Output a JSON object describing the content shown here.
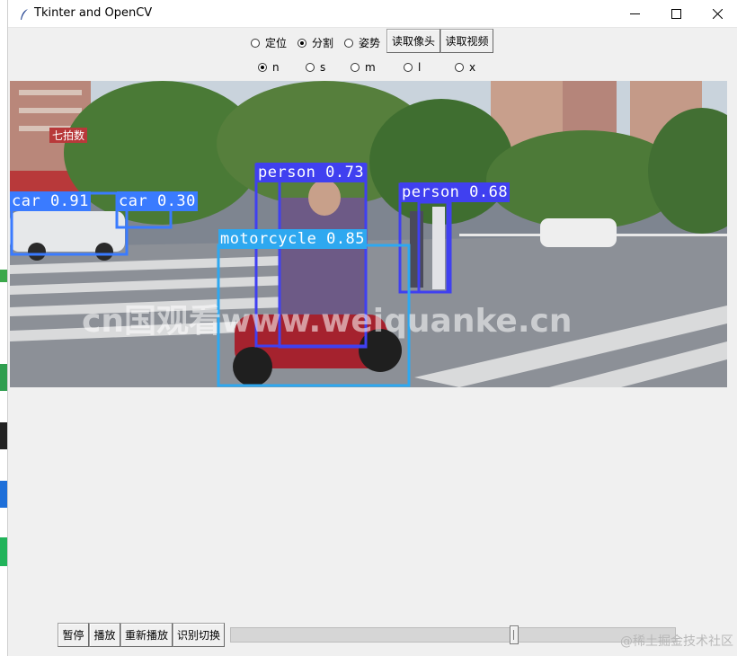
{
  "window": {
    "title": "Tkinter and OpenCV"
  },
  "toolbar": {
    "modes": [
      {
        "label": "定位",
        "selected": false
      },
      {
        "label": "分割",
        "selected": true
      },
      {
        "label": "姿势",
        "selected": false
      }
    ],
    "buttons": {
      "read_camera": "读取像头",
      "read_video": "读取视频"
    },
    "model_sizes": [
      {
        "label": "n",
        "selected": true
      },
      {
        "label": "s",
        "selected": false
      },
      {
        "label": "m",
        "selected": false
      },
      {
        "label": "l",
        "selected": false
      },
      {
        "label": "x",
        "selected": false
      }
    ]
  },
  "video": {
    "detections": [
      {
        "label": "car 0.91",
        "color": "#3a7bff"
      },
      {
        "label": "car 0.30",
        "color": "#3a7bff"
      },
      {
        "label": "person 0.73",
        "color": "#4040f0"
      },
      {
        "label": "person 0.68",
        "color": "#4040f0"
      },
      {
        "label": "motorcycle 0.85",
        "color": "#2ea8f0"
      }
    ],
    "overlay_text": "cn国观看www.weiquanke.cn",
    "shop_sign": "七拍数"
  },
  "controls": {
    "pause": "暂停",
    "play": "播放",
    "replay": "重新播放",
    "switch": "识别切换",
    "progress": 0.64
  },
  "watermark": "@稀土掘金技术社区",
  "colors": {
    "window_bg": "#f0f0f0",
    "titlebar_bg": "#ffffff"
  }
}
